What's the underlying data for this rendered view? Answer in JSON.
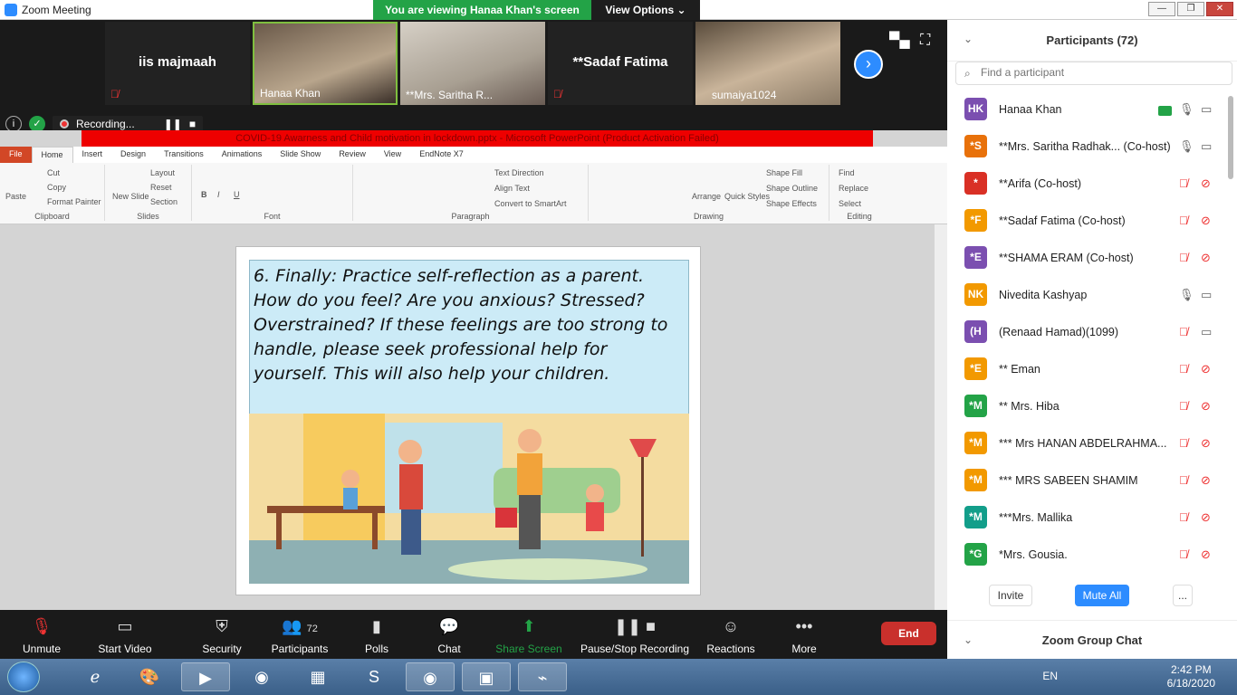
{
  "window": {
    "title": "Zoom Meeting",
    "viewing_banner": "You are viewing Hanaa Khan's screen",
    "view_options": "View Options"
  },
  "video_strip": {
    "tiles": [
      {
        "name": "iis majmaah",
        "camera": false
      },
      {
        "name": "Hanaa Khan",
        "camera": true
      },
      {
        "name": "**Mrs. Saritha R...",
        "camera": true
      },
      {
        "name": "**Sadaf Fatima",
        "camera": false
      },
      {
        "name": "sumaiya1024",
        "camera": true
      }
    ]
  },
  "recording": {
    "label": "Recording..."
  },
  "ppt": {
    "title": "COVID-19 Awarness and Child motivation in lockdown.pptx - Microsoft PowerPoint (Product Activation Failed)",
    "tabs": [
      "File",
      "Home",
      "Insert",
      "Design",
      "Transitions",
      "Animations",
      "Slide Show",
      "Review",
      "View",
      "EndNote X7"
    ],
    "groups": {
      "clipboard": "Clipboard",
      "slides": "Slides",
      "font": "Font",
      "paragraph": "Paragraph",
      "drawing": "Drawing",
      "editing": "Editing"
    },
    "items": {
      "paste": "Paste",
      "cut": "Cut",
      "copy": "Copy",
      "format_painter": "Format Painter",
      "new_slide": "New Slide",
      "layout": "Layout",
      "reset": "Reset",
      "section": "Section",
      "text_direction": "Text Direction",
      "align_text": "Align Text",
      "convert_smartart": "Convert to SmartArt",
      "arrange": "Arrange",
      "quick_styles": "Quick Styles",
      "shape_fill": "Shape Fill",
      "shape_outline": "Shape Outline",
      "shape_effects": "Shape Effects",
      "find": "Find",
      "replace": "Replace",
      "select": "Select"
    },
    "slide_text": "6. Finally: Practice self-reflection as a parent. How do you feel? Are you anxious? Stressed? Overstrained? If these feelings are too strong to handle, please seek professional help for yourself. This will also help your children."
  },
  "toolbar": {
    "unmute": "Unmute",
    "start_video": "Start Video",
    "security": "Security",
    "participants": "Participants",
    "participants_count": "72",
    "polls": "Polls",
    "chat": "Chat",
    "share_screen": "Share Screen",
    "pause_stop": "Pause/Stop Recording",
    "reactions": "Reactions",
    "more": "More",
    "end": "End"
  },
  "panel": {
    "title": "Participants (72)",
    "search_placeholder": "Find a participant",
    "participants": [
      {
        "initials": "HK",
        "name": "Hanaa Khan",
        "color": "#7b4fb0",
        "sharing": true,
        "mic_muted": false,
        "video_off": false
      },
      {
        "initials": "*S",
        "name": "**Mrs. Saritha Radhak... (Co-host)",
        "color": "#e8710a",
        "sharing": false,
        "mic_muted": false,
        "video_off": false
      },
      {
        "initials": "*",
        "name": "**Arifa (Co-host)",
        "color": "#d93025",
        "sharing": false,
        "mic_muted": true,
        "video_off": true
      },
      {
        "initials": "*F",
        "name": "**Sadaf Fatima (Co-host)",
        "color": "#f29900",
        "sharing": false,
        "mic_muted": true,
        "video_off": true
      },
      {
        "initials": "*E",
        "name": "**SHAMA ERAM (Co-host)",
        "color": "#7b4fb0",
        "sharing": false,
        "mic_muted": true,
        "video_off": true
      },
      {
        "initials": "NK",
        "name": "Nivedita Kashyap",
        "color": "#f29900",
        "sharing": false,
        "mic_muted": false,
        "video_off": false
      },
      {
        "initials": "(H",
        "name": "(Renaad Hamad)(1099)",
        "color": "#7b4fb0",
        "sharing": false,
        "mic_muted": true,
        "video_off": false
      },
      {
        "initials": "*E",
        "name": "** Eman",
        "color": "#f29900",
        "sharing": false,
        "mic_muted": true,
        "video_off": true
      },
      {
        "initials": "*M",
        "name": "** Mrs. Hiba",
        "color": "#23a347",
        "sharing": false,
        "mic_muted": true,
        "video_off": true
      },
      {
        "initials": "*M",
        "name": "*** Mrs HANAN ABDELRAHMA...",
        "color": "#f29900",
        "sharing": false,
        "mic_muted": true,
        "video_off": true
      },
      {
        "initials": "*M",
        "name": "*** MRS SABEEN SHAMIM",
        "color": "#f29900",
        "sharing": false,
        "mic_muted": true,
        "video_off": true
      },
      {
        "initials": "*M",
        "name": "***Mrs. Mallika",
        "color": "#129e8a",
        "sharing": false,
        "mic_muted": true,
        "video_off": true
      },
      {
        "initials": "*G",
        "name": "*Mrs. Gousia.",
        "color": "#23a347",
        "sharing": false,
        "mic_muted": true,
        "video_off": true
      }
    ],
    "invite": "Invite",
    "mute_all": "Mute All",
    "more": "...",
    "chat_title": "Zoom Group Chat"
  },
  "taskbar": {
    "language": "EN",
    "time": "2:42 PM",
    "date": "6/18/2020"
  }
}
